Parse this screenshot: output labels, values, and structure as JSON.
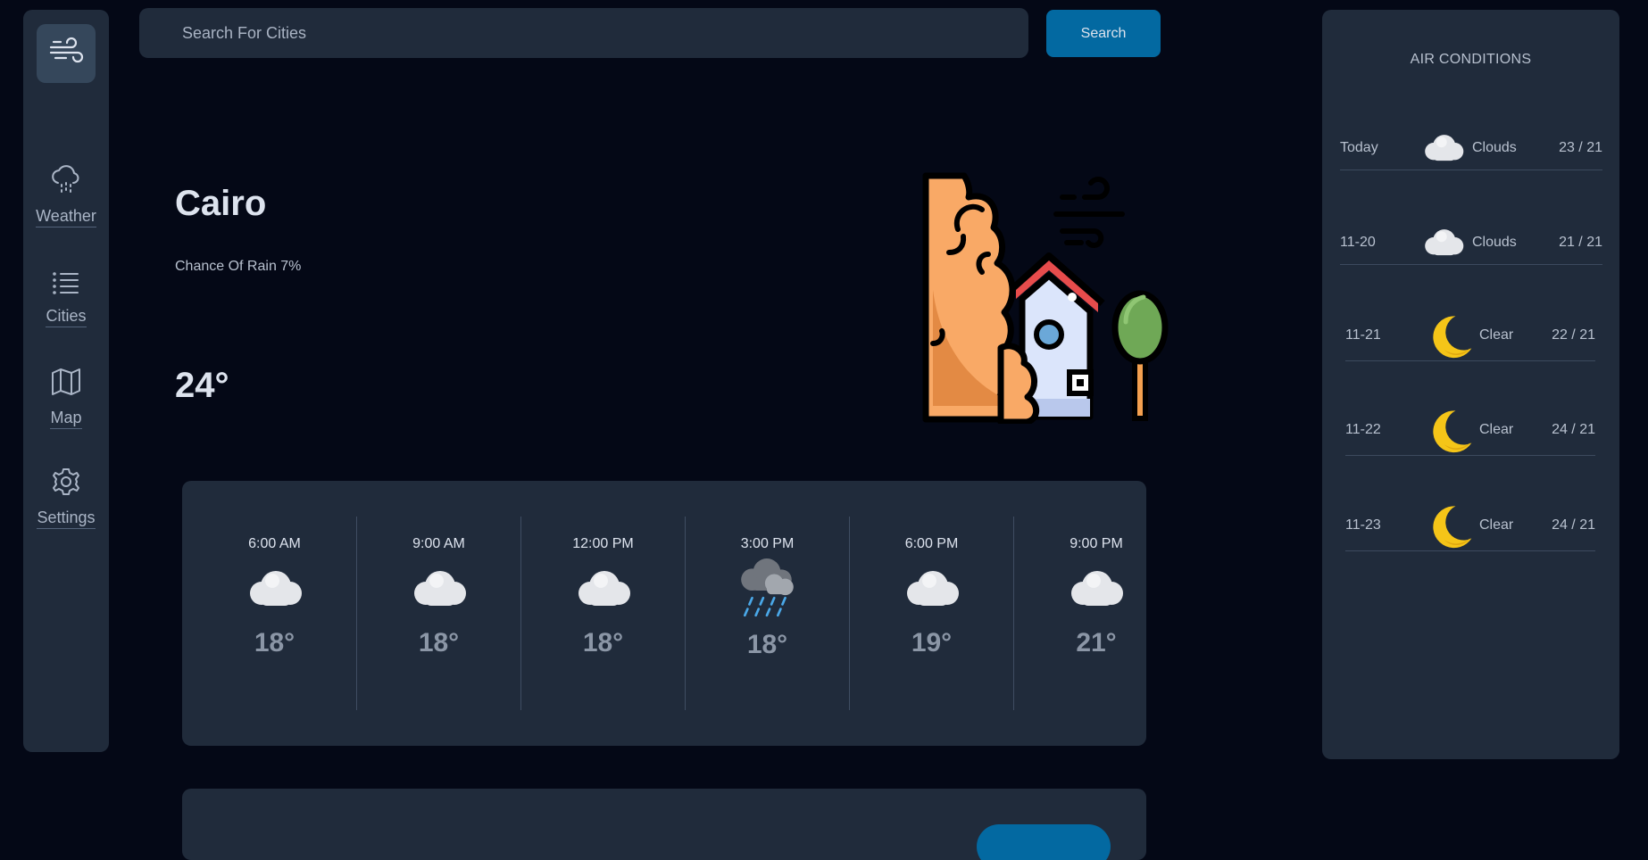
{
  "sidebar": {
    "logo_icon": "wind-icon",
    "items": [
      {
        "label": "Weather",
        "icon": "cloud-rain-icon"
      },
      {
        "label": "Cities",
        "icon": "list-icon"
      },
      {
        "label": "Map",
        "icon": "map-icon"
      },
      {
        "label": "Settings",
        "icon": "gear-icon"
      }
    ]
  },
  "search": {
    "placeholder": "Search For Cities",
    "button_label": "Search"
  },
  "current": {
    "city": "Cairo",
    "rain_chance": "Chance Of Rain 7%",
    "temperature": "24°",
    "illustration": "windy-house-illustration"
  },
  "hourly": [
    {
      "time": "6:00 AM",
      "icon": "cloud-icon",
      "temp": "18°"
    },
    {
      "time": "9:00 AM",
      "icon": "cloud-icon",
      "temp": "18°"
    },
    {
      "time": "12:00 PM",
      "icon": "cloud-icon",
      "temp": "18°"
    },
    {
      "time": "3:00 PM",
      "icon": "rain-cloud-icon",
      "temp": "18°"
    },
    {
      "time": "6:00 PM",
      "icon": "cloud-icon",
      "temp": "19°"
    },
    {
      "time": "9:00 PM",
      "icon": "cloud-icon",
      "temp": "21°"
    }
  ],
  "air_conditions": {
    "title": "AIR CONDITIONS",
    "days": [
      {
        "day": "Today",
        "icon": "cloud-icon",
        "condition": "Clouds",
        "temps": "23 / 21"
      },
      {
        "day": "11-20",
        "icon": "cloud-icon",
        "condition": "Clouds",
        "temps": "21 / 21"
      },
      {
        "day": "11-21",
        "icon": "moon-icon",
        "condition": "Clear",
        "temps": "22 / 21"
      },
      {
        "day": "11-22",
        "icon": "moon-icon",
        "condition": "Clear",
        "temps": "24 / 21"
      },
      {
        "day": "11-23",
        "icon": "moon-icon",
        "condition": "Clear",
        "temps": "24 / 21"
      }
    ]
  },
  "colors": {
    "background": "#040816",
    "panel": "#202b3b",
    "accent": "#0369a1",
    "text": "#dde3ee",
    "muted_temp": "#8b96a6",
    "moon": "#f5c518"
  }
}
